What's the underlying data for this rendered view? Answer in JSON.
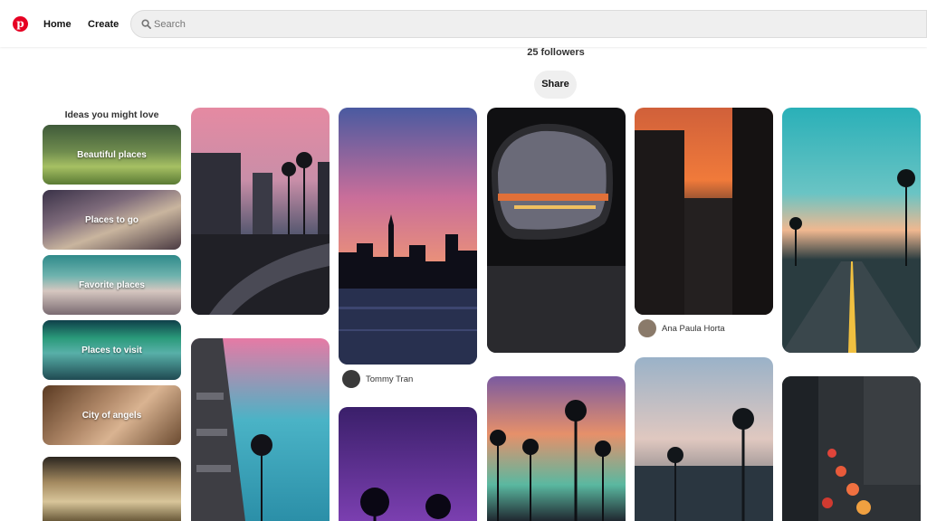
{
  "header": {
    "logo": "p",
    "nav": {
      "home": "Home",
      "create": "Create"
    },
    "search": {
      "placeholder": "Search",
      "value": ""
    }
  },
  "board": {
    "followers": "25 followers",
    "share_label": "Share"
  },
  "ideas": {
    "title": "Ideas you might love",
    "items": [
      {
        "label": "Beautiful places"
      },
      {
        "label": "Places to go"
      },
      {
        "label": "Favorite places"
      },
      {
        "label": "Places to visit"
      },
      {
        "label": "City of angels"
      }
    ]
  },
  "pins": [
    {
      "author": ""
    },
    {
      "author": "Tommy Tran"
    },
    {
      "author": ""
    },
    {
      "author": "Ana Paula Horta"
    },
    {
      "author": ""
    }
  ]
}
